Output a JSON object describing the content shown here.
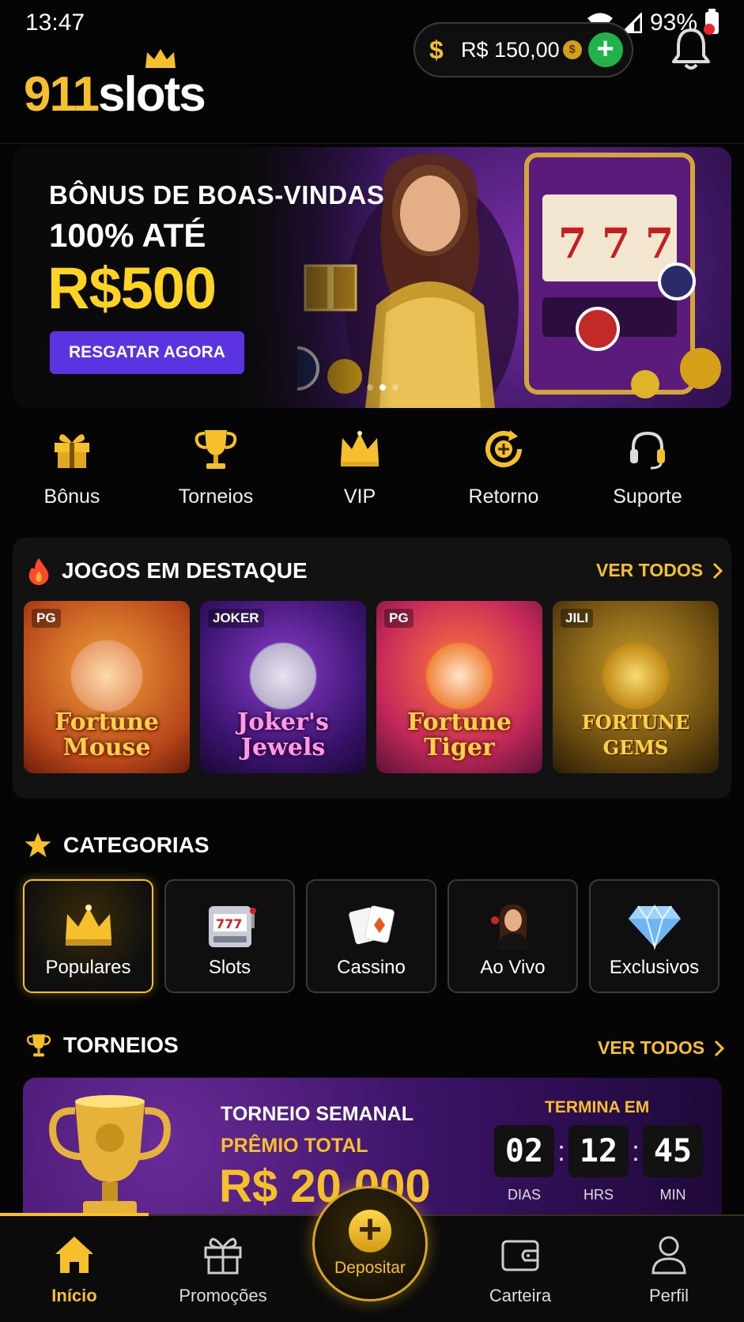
{
  "status": {
    "time": "13:47",
    "battery": "93%"
  },
  "header": {
    "logo_num": "911",
    "logo_text": "slots",
    "balance_currency_icon": "dollar-icon",
    "balance": "R$ 150,00",
    "coin_glyph": "$",
    "add_glyph": "+"
  },
  "banner": {
    "line1": "BÔNUS DE BOAS-VINDAS",
    "line2": "100% ATÉ",
    "amount": "R$500",
    "button": "RESGATAR AGORA"
  },
  "quicknav": [
    {
      "label": "Bônus",
      "icon": "gift-icon"
    },
    {
      "label": "Torneios",
      "icon": "trophy-icon"
    },
    {
      "label": "VIP",
      "icon": "crown-icon"
    },
    {
      "label": "Retorno",
      "icon": "cashback-icon"
    },
    {
      "label": "Suporte",
      "icon": "headset-icon"
    }
  ],
  "featured": {
    "title": "JOGOS EM DESTAQUE",
    "link": "VER TODOS",
    "games": [
      {
        "provider": "PG",
        "name": "Fortune Mouse"
      },
      {
        "provider": "JOKER",
        "name": "Joker's Jewels"
      },
      {
        "provider": "PG",
        "name": "Fortune Tiger"
      },
      {
        "provider": "JILI",
        "name": "FORTUNE GEMS"
      }
    ]
  },
  "categories": {
    "title": "CATEGORIAS",
    "items": [
      {
        "label": "Populares",
        "icon": "crown-icon"
      },
      {
        "label": "Slots",
        "icon": "slot-machine-icon"
      },
      {
        "label": "Cassino",
        "icon": "cards-icon"
      },
      {
        "label": "Ao Vivo",
        "icon": "live-dealer-icon"
      },
      {
        "label": "Exclusivos",
        "icon": "diamond-icon"
      }
    ]
  },
  "tournaments": {
    "title": "TORNEIOS",
    "link": "VER TODOS",
    "name": "TORNEIO SEMANAL",
    "prize_label": "PRÊMIO TOTAL",
    "prize": "R$ 20.000",
    "ends_label": "TERMINA EM",
    "timer": [
      {
        "value": "02",
        "unit": "DIAS"
      },
      {
        "value": "12",
        "unit": "HRS"
      },
      {
        "value": "45",
        "unit": "MIN"
      }
    ],
    "separator": ":"
  },
  "bottomnav": {
    "items": [
      {
        "label": "Início",
        "icon": "home-icon"
      },
      {
        "label": "Promoções",
        "icon": "gift-icon"
      },
      {
        "label": "Depositar",
        "icon": "plus-icon"
      },
      {
        "label": "Carteira",
        "icon": "wallet-icon"
      },
      {
        "label": "Perfil",
        "icon": "user-icon"
      }
    ],
    "plus_glyph": "+"
  },
  "colors": {
    "accent": "#f5c02b",
    "button": "#5b33e0",
    "green": "#22b24c",
    "notification": "#e8262a"
  }
}
